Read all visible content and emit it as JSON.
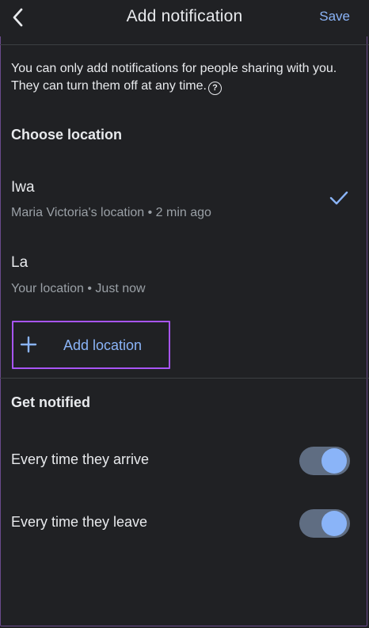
{
  "header": {
    "title": "Add notification",
    "save_label": "Save"
  },
  "info": {
    "text": "You can only add notifications for people sharing with you. They can turn them off at any time."
  },
  "choose_location": {
    "title": "Choose location",
    "items": [
      {
        "name": "Iwa",
        "subtitle": "Maria Victoria's location • 2 min ago",
        "selected": true
      },
      {
        "name": "La",
        "subtitle": "Your location • Just now",
        "selected": false
      }
    ],
    "add_label": "Add location"
  },
  "get_notified": {
    "title": "Get notified",
    "options": [
      {
        "label": "Every time they arrive",
        "enabled": true
      },
      {
        "label": "Every time they leave",
        "enabled": true
      }
    ]
  },
  "colors": {
    "background": "#202124",
    "accent": "#8ab4f8",
    "highlight_border": "#a855f7",
    "toggle_track": "#5f6d82"
  }
}
